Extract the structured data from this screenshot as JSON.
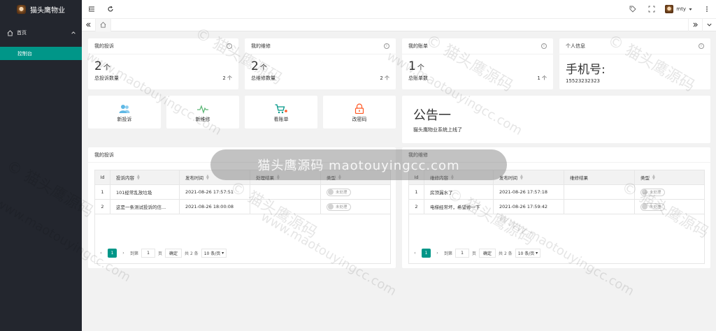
{
  "app": {
    "title": "猫头鹰物业"
  },
  "sidebar": {
    "parent_label": "首页",
    "child_label": "控制台"
  },
  "header": {
    "user_name": "mty"
  },
  "stats": [
    {
      "title": "我的投诉",
      "value": "2",
      "unit": "个",
      "foot_label": "总投诉数量",
      "foot_value": "2 个"
    },
    {
      "title": "我的维修",
      "value": "2",
      "unit": "个",
      "foot_label": "总维修数量",
      "foot_value": "2 个"
    },
    {
      "title": "我的账单",
      "value": "1",
      "unit": "个",
      "foot_label": "总账单数",
      "foot_value": "1 个"
    }
  ],
  "profile": {
    "title": "个人信息",
    "heading": "手机号:",
    "phone": "15523232323"
  },
  "quick_links": [
    {
      "label": "新投诉",
      "icon": "users-icon",
      "color": "#5fb8e5"
    },
    {
      "label": "新维修",
      "icon": "pulse-icon",
      "color": "#5fb878"
    },
    {
      "label": "看账单",
      "icon": "cart-icon",
      "color": "#009688"
    },
    {
      "label": "改密码",
      "icon": "lock-icon",
      "color": "#ff5722"
    }
  ],
  "notice": {
    "title": "公告一",
    "text": "猫头鹰物业系统上线了"
  },
  "complaints": {
    "title": "我的投诉",
    "columns": [
      "Id",
      "投诉内容",
      "发布时间",
      "处理结果",
      "类型"
    ],
    "rows": [
      {
        "id": "1",
        "content": "101经常乱放垃圾",
        "time": "2021-08-26 17:57:51",
        "result": "",
        "status": "未处理"
      },
      {
        "id": "2",
        "content": "这是一条测试投诉的信...",
        "time": "2021-08-26 18:00:08",
        "result": "",
        "status": "未处理"
      }
    ]
  },
  "repairs": {
    "title": "我的维修",
    "columns": [
      "Id",
      "维修内容",
      "发布时间",
      "维修结果",
      "类型"
    ],
    "rows": [
      {
        "id": "1",
        "content": "房顶漏水了",
        "time": "2021-08-26 17:57:18",
        "result": "",
        "status": "未处理"
      },
      {
        "id": "2",
        "content": "电梯经常坏，希望修一下",
        "time": "2021-08-26 17:59:42",
        "result": "",
        "status": "未处理"
      }
    ]
  },
  "pagination": {
    "current": "1",
    "goto_label": "到第",
    "goto_value": "1",
    "page_label": "页",
    "confirm_label": "确定",
    "total_label": "共 2 条",
    "per_page": "10 条/页"
  },
  "watermark": {
    "banner": "猫头鹰源码 maotouyingcc.com",
    "text": "© 猫头鹰源码",
    "url": "www.maotouyingcc.com"
  }
}
